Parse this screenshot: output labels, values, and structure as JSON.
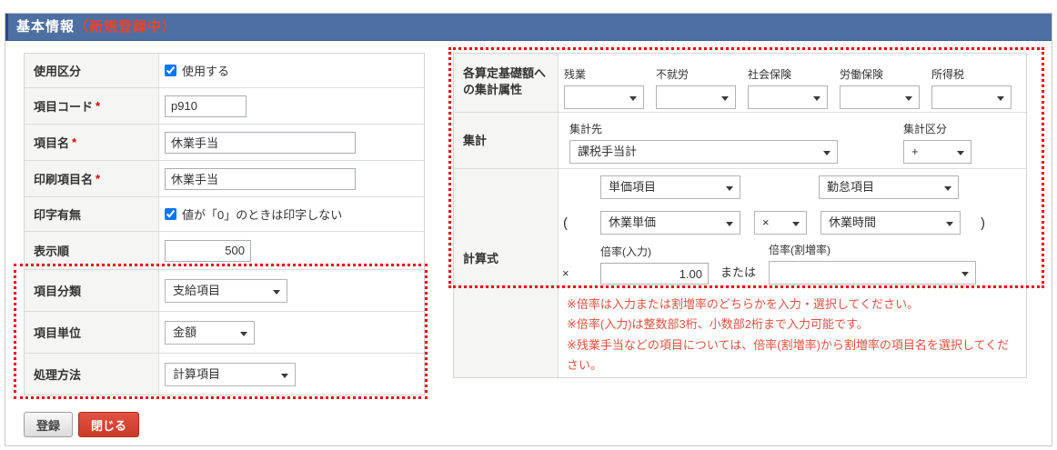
{
  "header": {
    "title": "基本情報",
    "status": "（新規登録中）"
  },
  "required_mark": "*",
  "left_form": {
    "rows": [
      {
        "label": "使用区分",
        "type": "checkbox",
        "checked": true,
        "text": "使用する"
      },
      {
        "label": "項目コード",
        "required": true,
        "type": "text",
        "value": "p910"
      },
      {
        "label": "項目名",
        "required": true,
        "type": "text",
        "value": "休業手当"
      },
      {
        "label": "印刷項目名",
        "required": true,
        "type": "text",
        "value": "休業手当"
      },
      {
        "label": "印字有無",
        "type": "checkbox",
        "checked": true,
        "text": "値が「0」のときは印字しない"
      },
      {
        "label": "表示順",
        "type": "text",
        "value": "500"
      },
      {
        "label": "項目分類",
        "type": "select",
        "value": "支給項目"
      },
      {
        "label": "項目単位",
        "type": "select",
        "value": "金額"
      },
      {
        "label": "処理方法",
        "type": "select",
        "value": "計算項目"
      }
    ]
  },
  "buttons": {
    "submit": "登録",
    "close": "閉じる"
  },
  "right_form": {
    "agg": {
      "label": "各算定基礎額への集計属性",
      "items": [
        {
          "label": "残業",
          "value": ""
        },
        {
          "label": "不就労",
          "value": ""
        },
        {
          "label": "社会保険",
          "value": ""
        },
        {
          "label": "労働保険",
          "value": ""
        },
        {
          "label": "所得税",
          "value": ""
        }
      ]
    },
    "sum": {
      "label": "集計",
      "dest_label": "集計先",
      "dest_value": "課税手当計",
      "type_label": "集計区分",
      "type_value": "+"
    },
    "formula": {
      "label": "計算式",
      "row1": {
        "left": "単価項目",
        "right": "勤怠項目"
      },
      "row2": {
        "open": "(",
        "left": "休業単価",
        "op": "×",
        "right": "休業時間",
        "close": ")"
      },
      "row3": {
        "times": "×",
        "input_label": "倍率(入力)",
        "input_value": "1.00",
        "or": "または",
        "select_label": "倍率(割増率)",
        "select_value": ""
      }
    },
    "notes": [
      "※倍率は入力または割増率のどちらかを入力・選択してください。",
      "※倍率(入力)は整数部3桁、小数部2桁まで入力可能です。",
      "※残業手当などの項目については、倍率(割増率)から割増率の項目名を選択してください。"
    ]
  },
  "colors": {
    "header_bg": "#4e6fa2",
    "status_red": "#e8432c",
    "note_red": "#e0523f",
    "dotted_red": "#ee0000",
    "close_button_red": "#d43f2c"
  }
}
